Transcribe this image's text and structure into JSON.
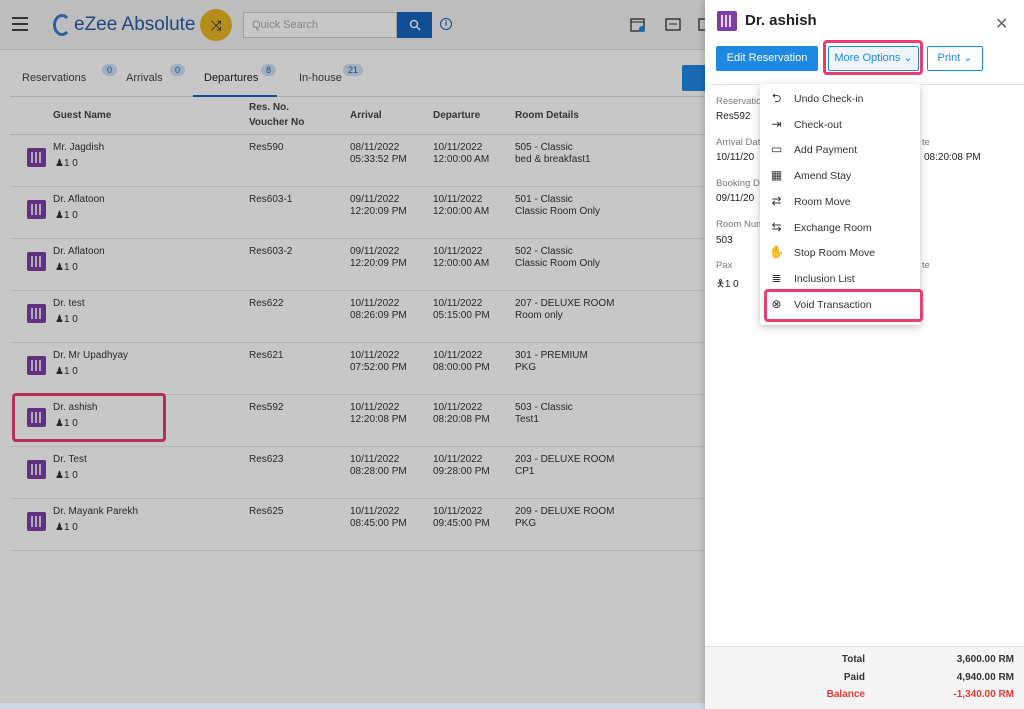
{
  "app": {
    "brand": "eZee Absolute",
    "search_placeholder": "Quick Search"
  },
  "tabs": [
    {
      "label": "Reservations",
      "count": "0"
    },
    {
      "label": "Arrivals",
      "count": "0"
    },
    {
      "label": "Departures",
      "count": "8"
    },
    {
      "label": "In-house",
      "count": "21"
    }
  ],
  "table": {
    "headers": {
      "guest": "Guest Name",
      "res_no": "Res. No.",
      "voucher": "Voucher No",
      "arrival": "Arrival",
      "departure": "Departure",
      "room": "Room Details"
    },
    "rows": [
      {
        "name": "Mr. Jagdish",
        "pax": "1  0",
        "res": "Res590",
        "arr_date": "08/11/2022",
        "arr_time": "05:33:52 PM",
        "dep_date": "10/11/2022",
        "dep_time": "12:00:00 AM",
        "room": "505 - Classic",
        "plan": "bed & breakfast1"
      },
      {
        "name": "Dr. Aflatoon",
        "pax": "1  0",
        "res": "Res603-1",
        "arr_date": "09/11/2022",
        "arr_time": "12:20:09 PM",
        "dep_date": "10/11/2022",
        "dep_time": "12:00:00 AM",
        "room": "501 - Classic",
        "plan": "Classic Room Only"
      },
      {
        "name": "Dr. Aflatoon",
        "pax": "1  0",
        "res": "Res603-2",
        "arr_date": "09/11/2022",
        "arr_time": "12:20:09 PM",
        "dep_date": "10/11/2022",
        "dep_time": "12:00:00 AM",
        "room": "502 - Classic",
        "plan": "Classic Room Only"
      },
      {
        "name": "Dr. test",
        "pax": "1  0",
        "res": "Res622",
        "arr_date": "10/11/2022",
        "arr_time": "08:26:09 PM",
        "dep_date": "10/11/2022",
        "dep_time": "05:15:00 PM",
        "room": "207 - DELUXE ROOM",
        "plan": "Room only"
      },
      {
        "name": "Dr. Mr Upadhyay",
        "pax": "1  0",
        "res": "Res621",
        "arr_date": "10/11/2022",
        "arr_time": "07:52:00 PM",
        "dep_date": "10/11/2022",
        "dep_time": "08:00:00 PM",
        "room": "301 - PREMIUM",
        "plan": "PKG"
      },
      {
        "name": "Dr. ashish",
        "pax": "1  0",
        "res": "Res592",
        "arr_date": "10/11/2022",
        "arr_time": "12:20:08 PM",
        "dep_date": "10/11/2022",
        "dep_time": "08:20:08 PM",
        "room": "503 - Classic",
        "plan": "Test1"
      },
      {
        "name": "Dr. Test",
        "pax": "1  0",
        "res": "Res623",
        "arr_date": "10/11/2022",
        "arr_time": "08:28:00 PM",
        "dep_date": "10/11/2022",
        "dep_time": "09:28:00 PM",
        "room": "203 - DELUXE ROOM",
        "plan": "CP1"
      },
      {
        "name": "Dr. Mayank Parekh",
        "pax": "1  0",
        "res": "Res625",
        "arr_date": "10/11/2022",
        "arr_time": "08:45:00 PM",
        "dep_date": "10/11/2022",
        "dep_time": "09:45:00 PM",
        "room": "209 - DELUXE ROOM",
        "plan": "PKG"
      }
    ]
  },
  "panel": {
    "title": "Dr. ashish",
    "edit_label": "Edit Reservation",
    "more_label": "More Options",
    "print_label": "Print",
    "fields": {
      "reservation_label": "Reservatio",
      "reservation_value": "Res592",
      "arrival_label": "Arrival Dat",
      "arrival_value": "10/11/20",
      "departure_label": "te",
      "departure_value": "08:20:08 PM",
      "booking_label": "Booking Da",
      "booking_value": "09/11/20",
      "room_label": "Room Num",
      "room_value": "503",
      "pax_label": "Pax",
      "pax_value": "1  0",
      "rate_label": "te"
    },
    "totals": {
      "total_label": "Total",
      "total_value": "3,600.00 RM",
      "paid_label": "Paid",
      "paid_value": "4,940.00 RM",
      "balance_label": "Balance",
      "balance_value": "-1,340.00 RM"
    }
  },
  "menu": [
    {
      "label": "Undo Check-in",
      "icon": "undo-checkin-icon"
    },
    {
      "label": "Check-out",
      "icon": "checkout-icon"
    },
    {
      "label": "Add Payment",
      "icon": "card-icon"
    },
    {
      "label": "Amend Stay",
      "icon": "calendar-edit-icon"
    },
    {
      "label": "Room Move",
      "icon": "bed-move-icon"
    },
    {
      "label": "Exchange Room",
      "icon": "bed-exchange-icon"
    },
    {
      "label": "Stop Room Move",
      "icon": "hand-stop-icon"
    },
    {
      "label": "Inclusion List",
      "icon": "inclusion-icon"
    },
    {
      "label": "Void Transaction",
      "icon": "void-circle-icon"
    }
  ],
  "colors": {
    "accent": "#1e88e5",
    "highlight": "#e83e6f",
    "guest_icon": "#7b3fa5",
    "balance": "#e53935"
  }
}
